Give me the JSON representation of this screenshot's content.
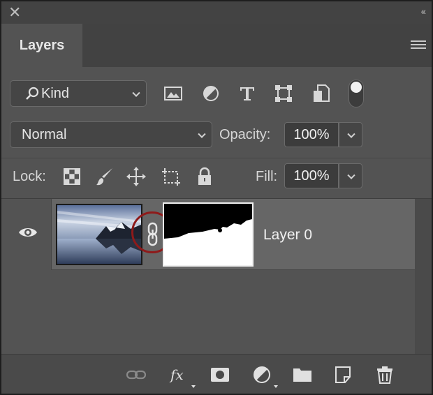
{
  "window": {
    "close_glyph": "✕",
    "collapse_glyph": "‹‹"
  },
  "panel": {
    "tab_label": "Layers"
  },
  "filter": {
    "kind_label": "Kind",
    "icons": [
      "image-filter-icon",
      "adjustment-filter-icon",
      "type-filter-icon",
      "shape-filter-icon",
      "smart-object-filter-icon"
    ],
    "toggle_on": true
  },
  "blend": {
    "mode": "Normal",
    "opacity_label": "Opacity:",
    "opacity_value": "100%"
  },
  "lock": {
    "label": "Lock:",
    "icons": [
      "lock-transparent-pixels-icon",
      "lock-image-pixels-icon",
      "lock-position-icon",
      "lock-artboard-icon",
      "lock-all-icon"
    ],
    "fill_label": "Fill:",
    "fill_value": "100%"
  },
  "layers": [
    {
      "name": "Layer 0",
      "visible": true,
      "has_mask": true,
      "linked": true
    }
  ],
  "footer_icons": [
    "link-layers-icon",
    "layer-style-icon",
    "add-mask-icon",
    "new-adjustment-icon",
    "new-group-icon",
    "new-layer-icon",
    "delete-layer-icon"
  ],
  "colors": {
    "panel_bg": "#535353",
    "selected_row": "#666666",
    "highlight_ring": "#8e1a1a"
  }
}
